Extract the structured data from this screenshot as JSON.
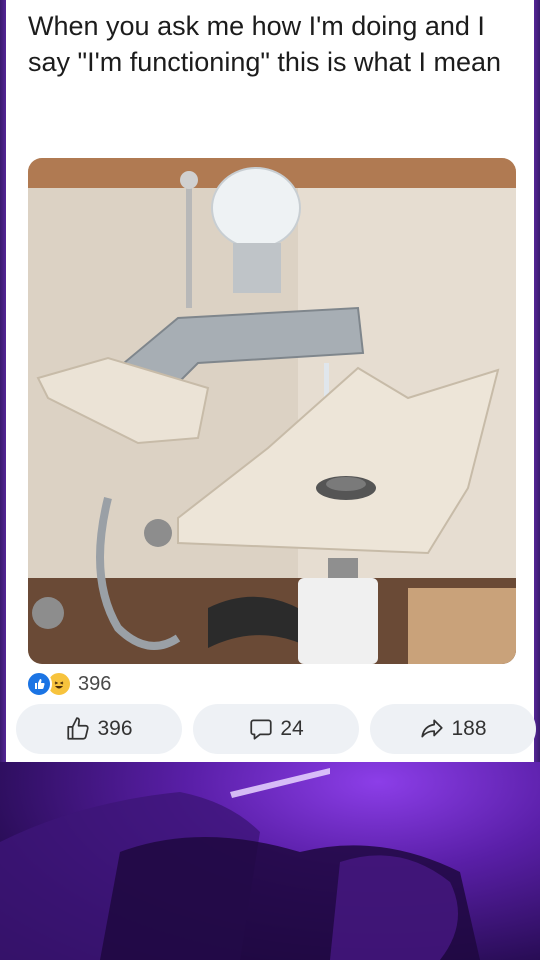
{
  "post": {
    "text": "When you ask me how I'm doing and I say \"I'm functioning\" this is what I mean"
  },
  "reactions": {
    "icons": [
      "like-icon",
      "haha-icon"
    ],
    "count": "396"
  },
  "actions": {
    "like_count": "396",
    "comment_count": "24",
    "share_count": "188"
  },
  "colors": {
    "like_blue": "#1b74e4",
    "haha_yellow": "#f7c33d",
    "button_bg": "#eef1f5",
    "backdrop_purple": "#6a2fb8"
  }
}
